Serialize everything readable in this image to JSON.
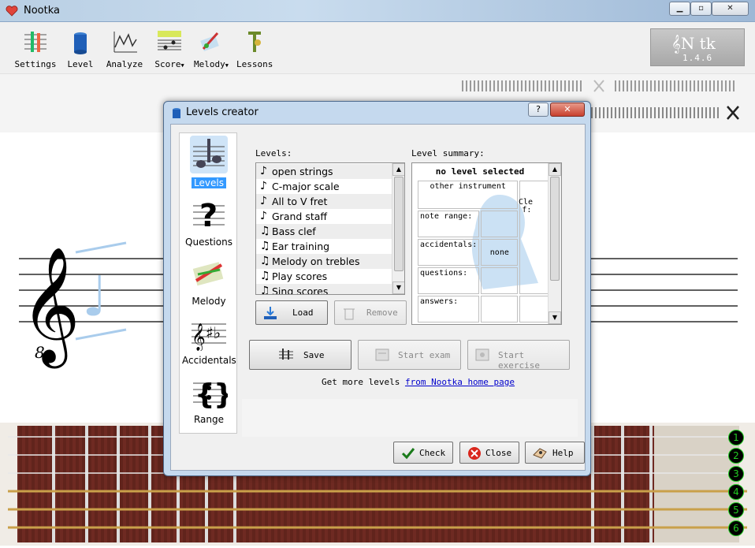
{
  "app": {
    "title": "Nootka",
    "window_buttons": [
      "minimize",
      "maximize",
      "close"
    ]
  },
  "toolbar": {
    "items": [
      {
        "label": "Settings",
        "icon": "settings-icon"
      },
      {
        "label": "Level",
        "icon": "level-icon"
      },
      {
        "label": "Analyze",
        "icon": "analyze-icon"
      },
      {
        "label": "Score",
        "icon": "score-icon",
        "has_menu": true
      },
      {
        "label": "Melody",
        "icon": "melody-icon",
        "has_menu": true
      },
      {
        "label": "Lessons",
        "icon": "lessons-icon"
      }
    ],
    "logo_version": "1.4.6"
  },
  "fretboard": {
    "string_numbers": [
      "1",
      "2",
      "3",
      "4",
      "5",
      "6"
    ]
  },
  "dialog": {
    "title": "Levels creator",
    "sidebar": [
      {
        "label": "Levels",
        "icon": "levels-icon",
        "selected": true
      },
      {
        "label": "Questions",
        "icon": "questions-icon",
        "selected": false
      },
      {
        "label": "Melody",
        "icon": "melody-icon",
        "selected": false
      },
      {
        "label": "Accidentals",
        "icon": "accidentals-icon",
        "selected": false
      },
      {
        "label": "Range",
        "icon": "range-icon",
        "selected": false
      }
    ],
    "levels_label": "Levels:",
    "levels": [
      {
        "name": "open strings",
        "note": "♪"
      },
      {
        "name": "C-major scale",
        "note": "♪"
      },
      {
        "name": "All to V fret",
        "note": "♪"
      },
      {
        "name": "Grand staff",
        "note": "♪"
      },
      {
        "name": "Bass clef",
        "note": "♫"
      },
      {
        "name": "Ear training",
        "note": "♫"
      },
      {
        "name": "Melody on trebles",
        "note": "♫"
      },
      {
        "name": "Play scores",
        "note": "♫"
      },
      {
        "name": "Sing scores",
        "note": "♫"
      }
    ],
    "summary_label": "Level summary:",
    "summary": {
      "heading": "no level selected",
      "instrument_label": "other instrument",
      "clef_label": "Cle",
      "f_label": "f:",
      "note_range_label": "note range:",
      "accidentals_label": "accidentals:",
      "accidentals_value": "none",
      "questions_label": "questions:",
      "answers_label": "answers:"
    },
    "buttons": {
      "load": "Load",
      "remove": "Remove",
      "save": "Save",
      "start_exam": "Start exam",
      "start_exercise": "Start exercise",
      "check": "Check",
      "close": "Close",
      "help": "Help"
    },
    "get_more_text": "Get more levels ",
    "get_more_link": "from Nootka home page"
  }
}
